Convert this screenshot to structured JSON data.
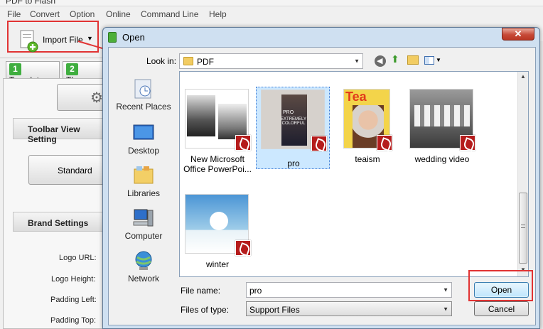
{
  "app": {
    "window_title": "PDF to Flash",
    "menu": [
      "File",
      "Convert",
      "Option",
      "Online",
      "Command Line",
      "Help"
    ],
    "toolbar": {
      "import_label": "Import File"
    },
    "tabs": [
      {
        "num": "1",
        "label": "Template"
      },
      {
        "num": "2",
        "label": "Theme"
      }
    ],
    "left": {
      "toolbar_view_heading": "Toolbar View Setting",
      "standard_label": "Standard",
      "brand_heading": "Brand Settings",
      "fields": [
        "Logo URL:",
        "Logo Height:",
        "Padding Left:",
        "Padding Top:"
      ]
    }
  },
  "dialog": {
    "title": "Open",
    "close_glyph": "✕",
    "look_in_label": "Look in:",
    "look_in_value": "PDF",
    "places": [
      "Recent Places",
      "Desktop",
      "Libraries",
      "Computer",
      "Network"
    ],
    "files": [
      {
        "name": "New Microsoft Office PowerPoi...",
        "selected": false
      },
      {
        "name": "pro",
        "selected": true
      },
      {
        "name": "teaism",
        "selected": false
      },
      {
        "name": "wedding video",
        "selected": false
      },
      {
        "name": "winter",
        "selected": false
      }
    ],
    "file_name_label": "File name:",
    "file_name_value": "pro",
    "file_type_label": "Files of type:",
    "file_type_value": "Support Files",
    "open_label": "Open",
    "cancel_label": "Cancel",
    "thumb_texts": {
      "pro_line1": "PRO",
      "pro_line2": "EXTREMELY COLORFUL",
      "tea_logo": "Tea"
    }
  },
  "colors": {
    "annotation_red": "#e13333",
    "pdf_badge_red": "#b51c1c",
    "selection_blue": "#cce8ff",
    "tab_green": "#3fae3f"
  }
}
